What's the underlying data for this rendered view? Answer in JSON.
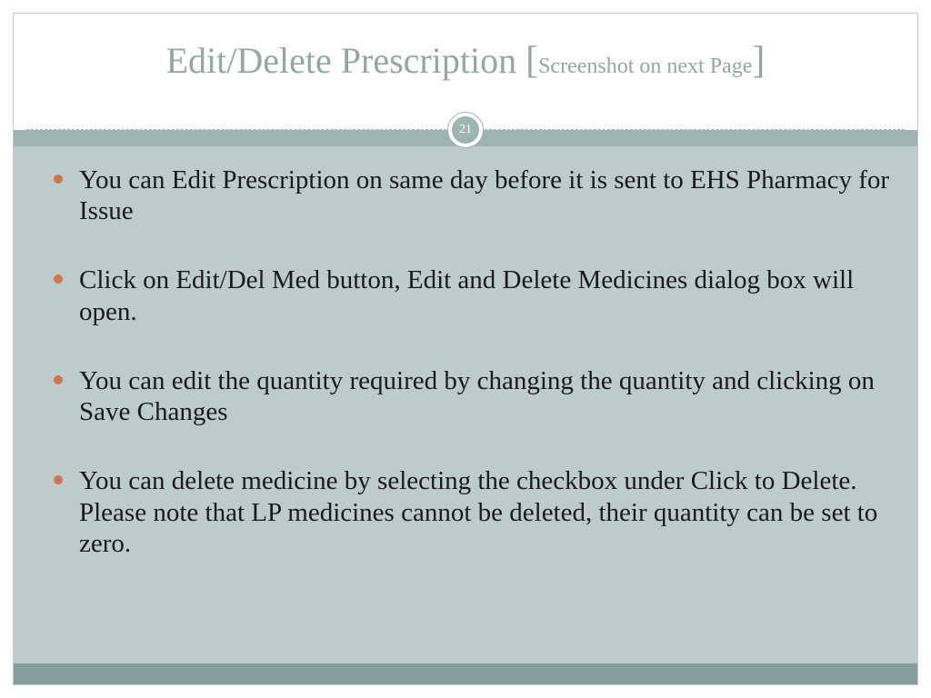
{
  "title": {
    "main": "Edit/Delete Prescription ",
    "bracket_open": "[",
    "sub": "Screenshot on next Page",
    "bracket_close": "]"
  },
  "page_number": "21",
  "bullets": [
    "You can Edit Prescription  on same day before it is sent to EHS Pharmacy for Issue",
    "Click on Edit/Del Med button, Edit and Delete Medicines dialog box will open.",
    "You can edit the quantity required by changing the quantity and clicking on Save Changes",
    "You can delete medicine by selecting the checkbox under Click to Delete.  Please note that LP medicines cannot be deleted, their quantity can be set to zero."
  ]
}
